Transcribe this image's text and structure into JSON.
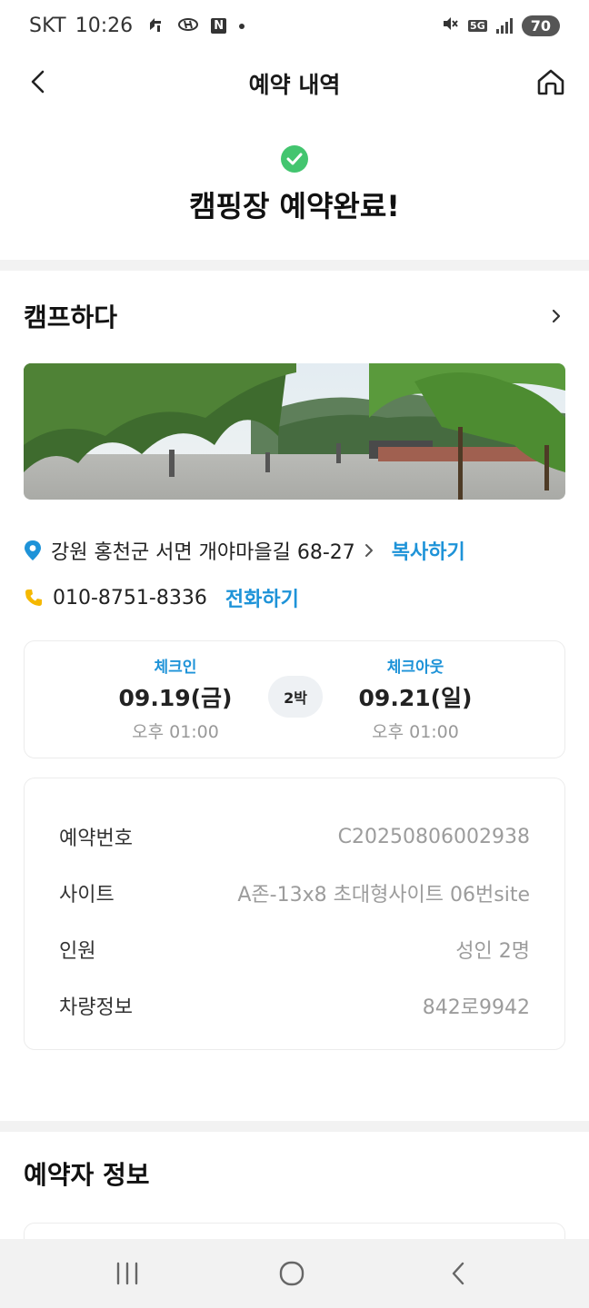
{
  "status_bar": {
    "carrier": "SKT",
    "time": "10:26",
    "network": "5G",
    "battery": "70"
  },
  "header": {
    "title": "예약 내역"
  },
  "completion": {
    "message": "캠핑장 예약완료!"
  },
  "camp": {
    "name": "캠프하다",
    "address": "강원 홍천군 서면 개야마을길 68-27",
    "copy_label": "복사하기",
    "phone": "010-8751-8336",
    "call_label": "전화하기"
  },
  "schedule": {
    "checkin_label": "체크인",
    "checkin_date": "09.19(금)",
    "checkin_time": "오후 01:00",
    "nights": "2박",
    "checkout_label": "체크아웃",
    "checkout_date": "09.21(일)",
    "checkout_time": "오후 01:00"
  },
  "details": [
    {
      "key": "예약번호",
      "value": "C20250806002938"
    },
    {
      "key": "사이트",
      "value": "A존-13x8 초대형사이트 06번site"
    },
    {
      "key": "인원",
      "value": "성인 2명"
    },
    {
      "key": "차량정보",
      "value": "842로9942"
    }
  ],
  "reserver": {
    "title": "예약자 정보"
  },
  "colors": {
    "accent_blue": "#1e93d8",
    "success_green": "#43c56f",
    "pin_blue": "#1e93d8",
    "phone_yellow": "#f5b800"
  }
}
